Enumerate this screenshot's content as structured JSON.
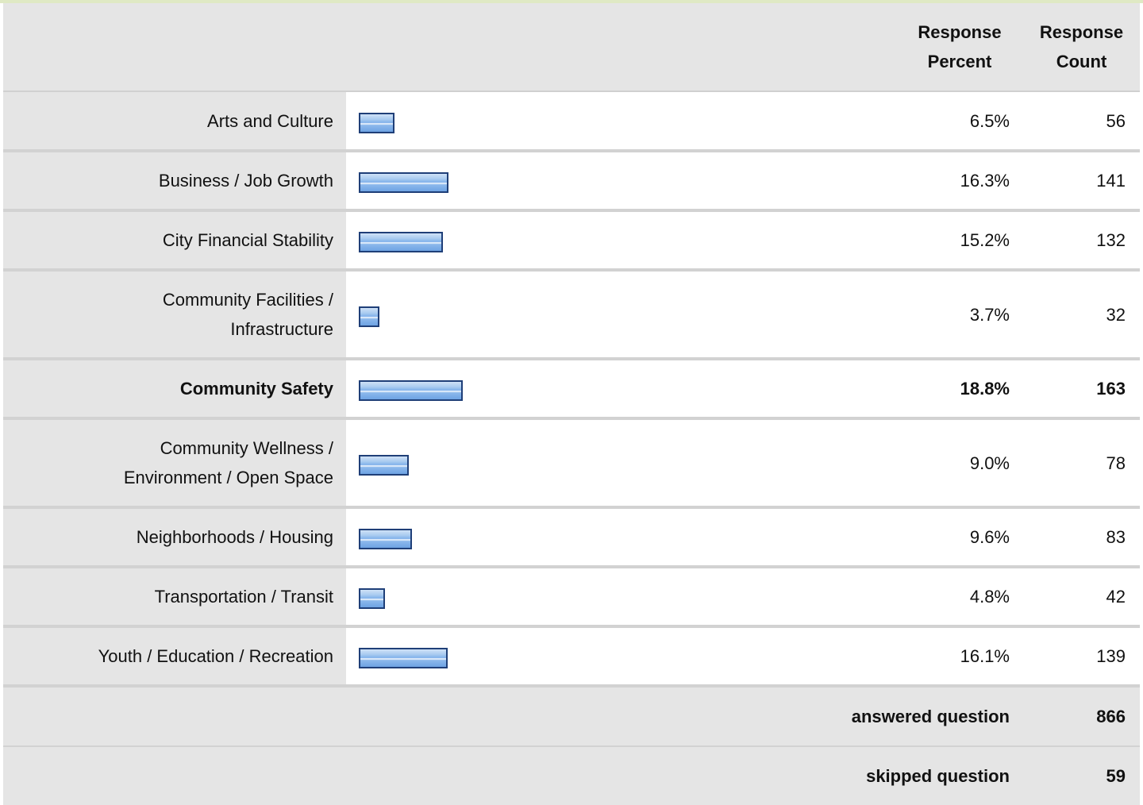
{
  "table": {
    "col_percent_label": [
      "Response",
      "Percent"
    ],
    "col_count_label": [
      "Response",
      "Count"
    ]
  },
  "chart_data": {
    "type": "bar",
    "categories": [
      "Arts and Culture",
      "Business / Job Growth",
      "City Financial Stability",
      "Community Facilities / Infrastructure",
      "Community Safety",
      "Community Wellness / Environment / Open Space",
      "Neighborhoods / Housing",
      "Transportation / Transit",
      "Youth / Education / Recreation"
    ],
    "values": [
      6.5,
      16.3,
      15.2,
      3.7,
      18.8,
      9.0,
      9.6,
      4.8,
      16.1
    ],
    "rows": [
      {
        "label_lines": [
          "Arts and Culture"
        ],
        "percent": "6.5%",
        "count": "56",
        "bold": false
      },
      {
        "label_lines": [
          "Business / Job Growth"
        ],
        "percent": "16.3%",
        "count": "141",
        "bold": false
      },
      {
        "label_lines": [
          "City Financial Stability"
        ],
        "percent": "15.2%",
        "count": "132",
        "bold": false
      },
      {
        "label_lines": [
          "Community Facilities /",
          "Infrastructure"
        ],
        "percent": "3.7%",
        "count": "32",
        "bold": false
      },
      {
        "label_lines": [
          "Community Safety"
        ],
        "percent": "18.8%",
        "count": "163",
        "bold": true
      },
      {
        "label_lines": [
          "Community Wellness /",
          "Environment / Open Space"
        ],
        "percent": "9.0%",
        "count": "78",
        "bold": false
      },
      {
        "label_lines": [
          "Neighborhoods / Housing"
        ],
        "percent": "9.6%",
        "count": "83",
        "bold": false
      },
      {
        "label_lines": [
          "Transportation / Transit"
        ],
        "percent": "4.8%",
        "count": "42",
        "bold": false
      },
      {
        "label_lines": [
          "Youth / Education / Recreation"
        ],
        "percent": "16.1%",
        "count": "139",
        "bold": false
      }
    ],
    "xlim": [
      0,
      100
    ],
    "bar_color": "#7fb0ea",
    "bar_border_color": "#1f3f78"
  },
  "summary": {
    "answered_label": "answered question",
    "answered_value": "866",
    "skipped_label": "skipped question",
    "skipped_value": "59"
  }
}
